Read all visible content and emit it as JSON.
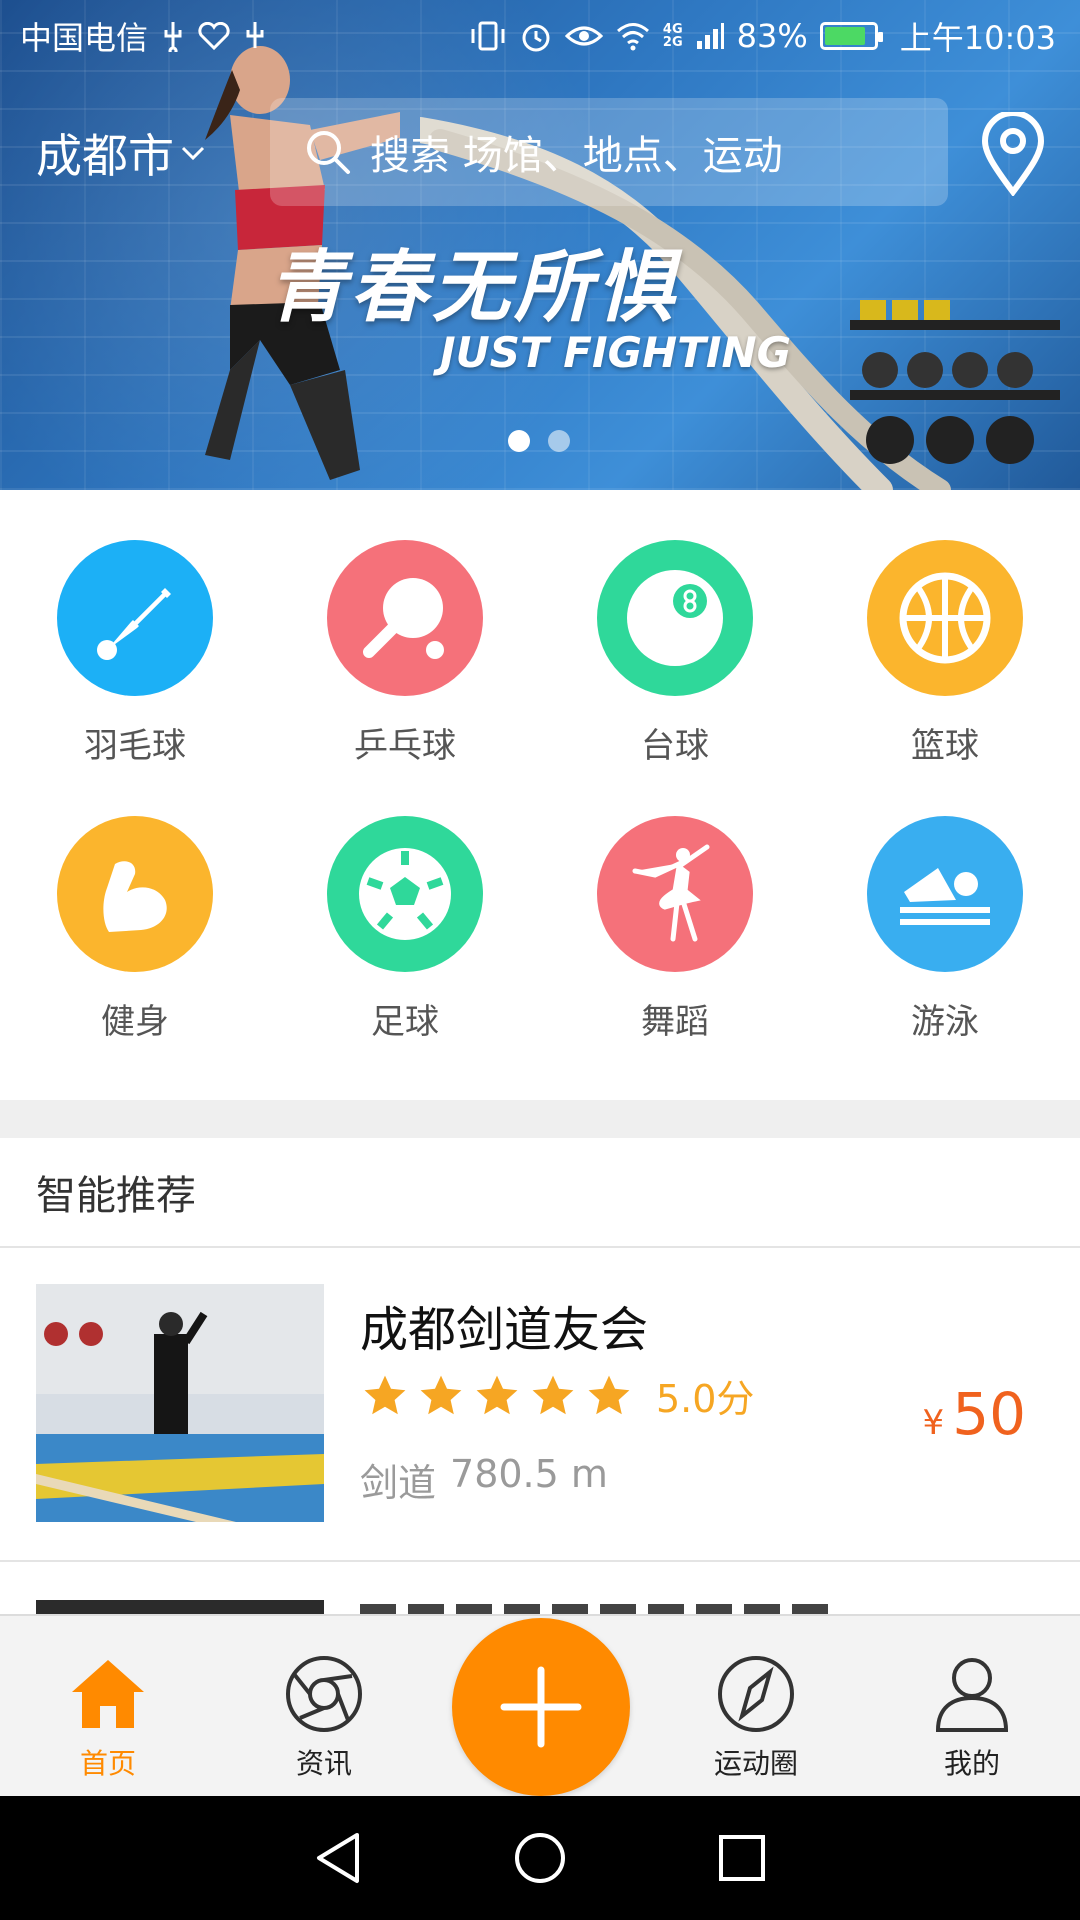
{
  "status_bar": {
    "carrier": "中国电信",
    "network": "4G",
    "network_sub": "2G",
    "battery": "83%",
    "battery_level": 0.83,
    "time": "上午10:03"
  },
  "header": {
    "city": "成都市",
    "search_placeholder": "搜索 场馆、地点、运动"
  },
  "banner": {
    "title": "青春无所惧",
    "subtitle": "JUST FIGHTING",
    "page_count": 2,
    "active_page": 1
  },
  "categories": [
    {
      "label": "羽毛球",
      "color": "#1cb0f6",
      "icon": "shuttlecock-icon"
    },
    {
      "label": "乒乓球",
      "color": "#f5717a",
      "icon": "ping-pong-icon"
    },
    {
      "label": "台球",
      "color": "#2fd89a",
      "icon": "billiard-ball-icon"
    },
    {
      "label": "篮球",
      "color": "#fbb52d",
      "icon": "basketball-icon"
    },
    {
      "label": "健身",
      "color": "#fbb52d",
      "icon": "muscle-arm-icon"
    },
    {
      "label": "足球",
      "color": "#2fd89a",
      "icon": "soccer-ball-icon"
    },
    {
      "label": "舞蹈",
      "color": "#f5717a",
      "icon": "ballet-dancer-icon"
    },
    {
      "label": "游泳",
      "color": "#39aef0",
      "icon": "swimmer-icon"
    }
  ],
  "recommend": {
    "title": "智能推荐",
    "items": [
      {
        "name": "成都剑道友会",
        "rating": "5.0分",
        "stars": 5,
        "sport": "剑道",
        "distance": "780.5 m",
        "currency": "¥",
        "price": "50"
      }
    ]
  },
  "tabs": [
    {
      "label": "首页",
      "icon": "home-icon",
      "active": true
    },
    {
      "label": "资讯",
      "icon": "aperture-icon",
      "active": false
    },
    {
      "label": "运动圈",
      "icon": "compass-icon",
      "active": false
    },
    {
      "label": "我的",
      "icon": "user-icon",
      "active": false
    }
  ],
  "colors": {
    "accent": "#ff8a00",
    "price": "#f0621e",
    "star": "#f6a623"
  }
}
